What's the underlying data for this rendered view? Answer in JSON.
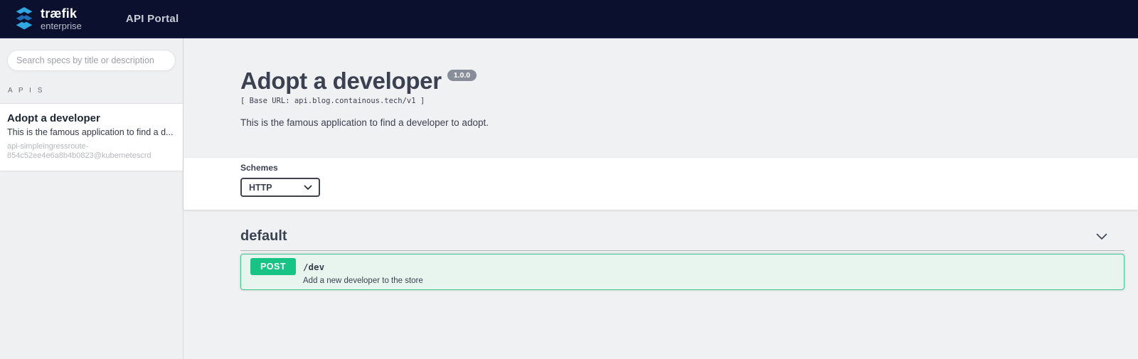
{
  "navbar": {
    "brand": "træfik",
    "brand_sub": "enterprise",
    "title": "API Portal"
  },
  "sidebar": {
    "search_placeholder": "Search specs by title or description",
    "section_label": "A P I S",
    "items": [
      {
        "title": "Adopt a developer",
        "description": "This is the famous application to find a d...",
        "id": "api-simpleingressroute-854c52ee4e6a8b4b0823@kubernetescrd"
      }
    ]
  },
  "main": {
    "title": "Adopt a developer",
    "version_badge": "1.0.0",
    "base_url_line": "[ Base URL: api.blog.containous.tech/v1 ]",
    "description": "This is the famous application to find a developer to adopt.",
    "schemes": {
      "label": "Schemes",
      "selected": "HTTP"
    },
    "sections": [
      {
        "name": "default",
        "operations": [
          {
            "method": "POST",
            "path": "/dev",
            "summary": "Add a new developer to the store"
          }
        ]
      }
    ]
  },
  "colors": {
    "navbar_bg": "#0a102e",
    "logo_blue_light": "#2fa8e1",
    "logo_blue_dark": "#1e6eb5",
    "method_post_green": "#17c385",
    "opblock_bg": "#e7f5ee",
    "opblock_border": "#41c78f",
    "version_badge_bg": "#878e9a",
    "text_primary": "#3b4151",
    "page_bg": "#f0f1f3"
  }
}
